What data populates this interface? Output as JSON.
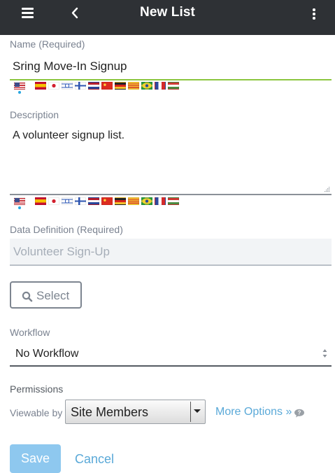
{
  "header": {
    "title": "New List",
    "menu_icon": "hamburger-icon",
    "back_icon": "chevron-left-icon",
    "more_icon": "vertical-ellipsis-icon",
    "background": "#2e3135"
  },
  "name_field": {
    "label": "Name (Required)",
    "value": "Sring Move-In Signup",
    "underline_color": "#8cc63f"
  },
  "locales": [
    "en-US",
    "es-ES",
    "ja-JP",
    "iw-IL",
    "fi-FI",
    "nl-NL",
    "zh-CN",
    "de-DE",
    "ca-ES",
    "pt-BR",
    "fr-FR",
    "hu-HU"
  ],
  "description_field": {
    "label": "Description",
    "value": "A volunteer signup list."
  },
  "data_definition": {
    "label": "Data Definition (Required)",
    "placeholder": "Volunteer Sign-Up"
  },
  "select_button": {
    "label": "Select",
    "icon": "search-icon"
  },
  "workflow": {
    "label": "Workflow",
    "value": "No Workflow"
  },
  "permissions": {
    "label": "Permissions",
    "viewable_by_label": "Viewable by",
    "viewable_by_value": "Site Members",
    "more_options": "More Options »",
    "help_icon": "question-bubble-icon"
  },
  "actions": {
    "save": "Save",
    "cancel": "Cancel"
  },
  "colors": {
    "accent": "#5aa9d8",
    "save_button": "#8ec8ef",
    "active_locale_dot": "#29a6e0"
  }
}
